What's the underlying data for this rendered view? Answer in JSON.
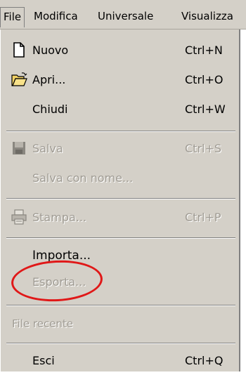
{
  "menubar": {
    "items": [
      {
        "label": "File",
        "active": true
      },
      {
        "label": "Modifica"
      },
      {
        "label": "Universale"
      },
      {
        "label": "Visualizza"
      }
    ]
  },
  "file_menu": {
    "items": [
      {
        "label": "Nuovo",
        "shortcut": "Ctrl+N",
        "icon": "new-document-icon",
        "enabled": true
      },
      {
        "label": "Apri...",
        "shortcut": "Ctrl+O",
        "icon": "open-folder-icon",
        "enabled": true
      },
      {
        "label": "Chiudi",
        "shortcut": "Ctrl+W",
        "enabled": true
      },
      {
        "label": "Salva",
        "shortcut": "Ctrl+S",
        "icon": "floppy-disk-icon",
        "enabled": false
      },
      {
        "label": "Salva con nome...",
        "shortcut": "",
        "enabled": false
      },
      {
        "label": "Stampa...",
        "shortcut": "Ctrl+P",
        "icon": "printer-icon",
        "enabled": false
      },
      {
        "label": "Importa...",
        "shortcut": "",
        "enabled": true,
        "highlighted": true
      },
      {
        "label": "Esporta...",
        "shortcut": "",
        "enabled": false
      },
      {
        "label": "Esci",
        "shortcut": "Ctrl+Q",
        "enabled": true
      }
    ],
    "recent_header": "File recente"
  },
  "colors": {
    "menu_bg": "#d4d0c8",
    "disabled_text": "#a09c94",
    "highlight_circle": "#e01818"
  }
}
